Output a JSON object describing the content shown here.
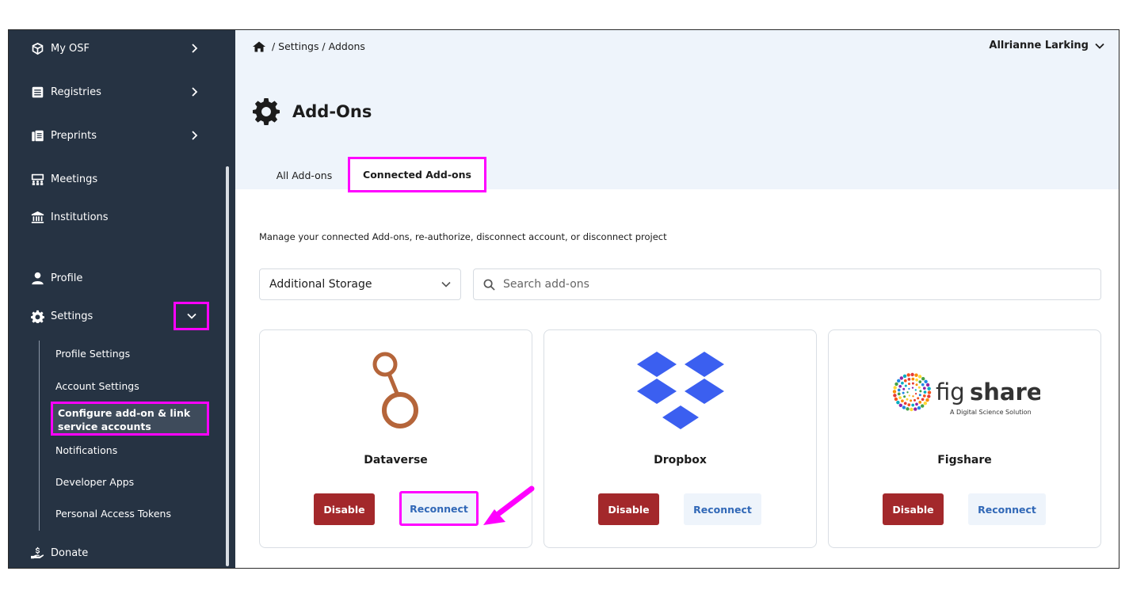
{
  "sidebar": {
    "items": [
      {
        "label": "My OSF",
        "icon": "cube-icon"
      },
      {
        "label": "Registries",
        "icon": "registries-icon"
      },
      {
        "label": "Preprints",
        "icon": "preprints-icon"
      },
      {
        "label": "Meetings",
        "icon": "meetings-icon"
      },
      {
        "label": "Institutions",
        "icon": "institution-icon"
      },
      {
        "label": "Profile",
        "icon": "user-icon"
      },
      {
        "label": "Settings",
        "icon": "gear-icon"
      },
      {
        "label": "Donate",
        "icon": "donate-icon"
      }
    ],
    "settings_sub": [
      "Profile Settings",
      "Account Settings",
      "Configure add-on & link service accounts",
      "Notifications",
      "Developer Apps",
      "Personal Access Tokens"
    ]
  },
  "header": {
    "breadcrumb": "/ Settings / Addons",
    "user_name": "Allrianne Larking",
    "title": "Add-Ons"
  },
  "tabs": [
    {
      "label": "All Add-ons",
      "active": false
    },
    {
      "label": "Connected Add-ons",
      "active": true
    }
  ],
  "main": {
    "description": "Manage your connected Add-ons, re-authorize, disconnect account, or disconnect project",
    "filter_value": "Additional Storage",
    "search_placeholder": "Search add-ons"
  },
  "cards": [
    {
      "name": "Dataverse",
      "disable_label": "Disable",
      "reconnect_label": "Reconnect",
      "logo": "dataverse-logo-icon"
    },
    {
      "name": "Dropbox",
      "disable_label": "Disable",
      "reconnect_label": "Reconnect",
      "logo": "dropbox-logo-icon"
    },
    {
      "name": "Figshare",
      "disable_label": "Disable",
      "reconnect_label": "Reconnect",
      "logo": "figshare-logo-icon",
      "logo_text": {
        "fig": "fig",
        "share": "share",
        "tagline": "A Digital Science Solution"
      }
    }
  ],
  "colors": {
    "sidebar_bg": "#263343",
    "header_bg": "#eef4fb",
    "disable_bg": "#a3282b",
    "reconnect_text": "#3168b7",
    "highlight": "#ff00ff"
  }
}
